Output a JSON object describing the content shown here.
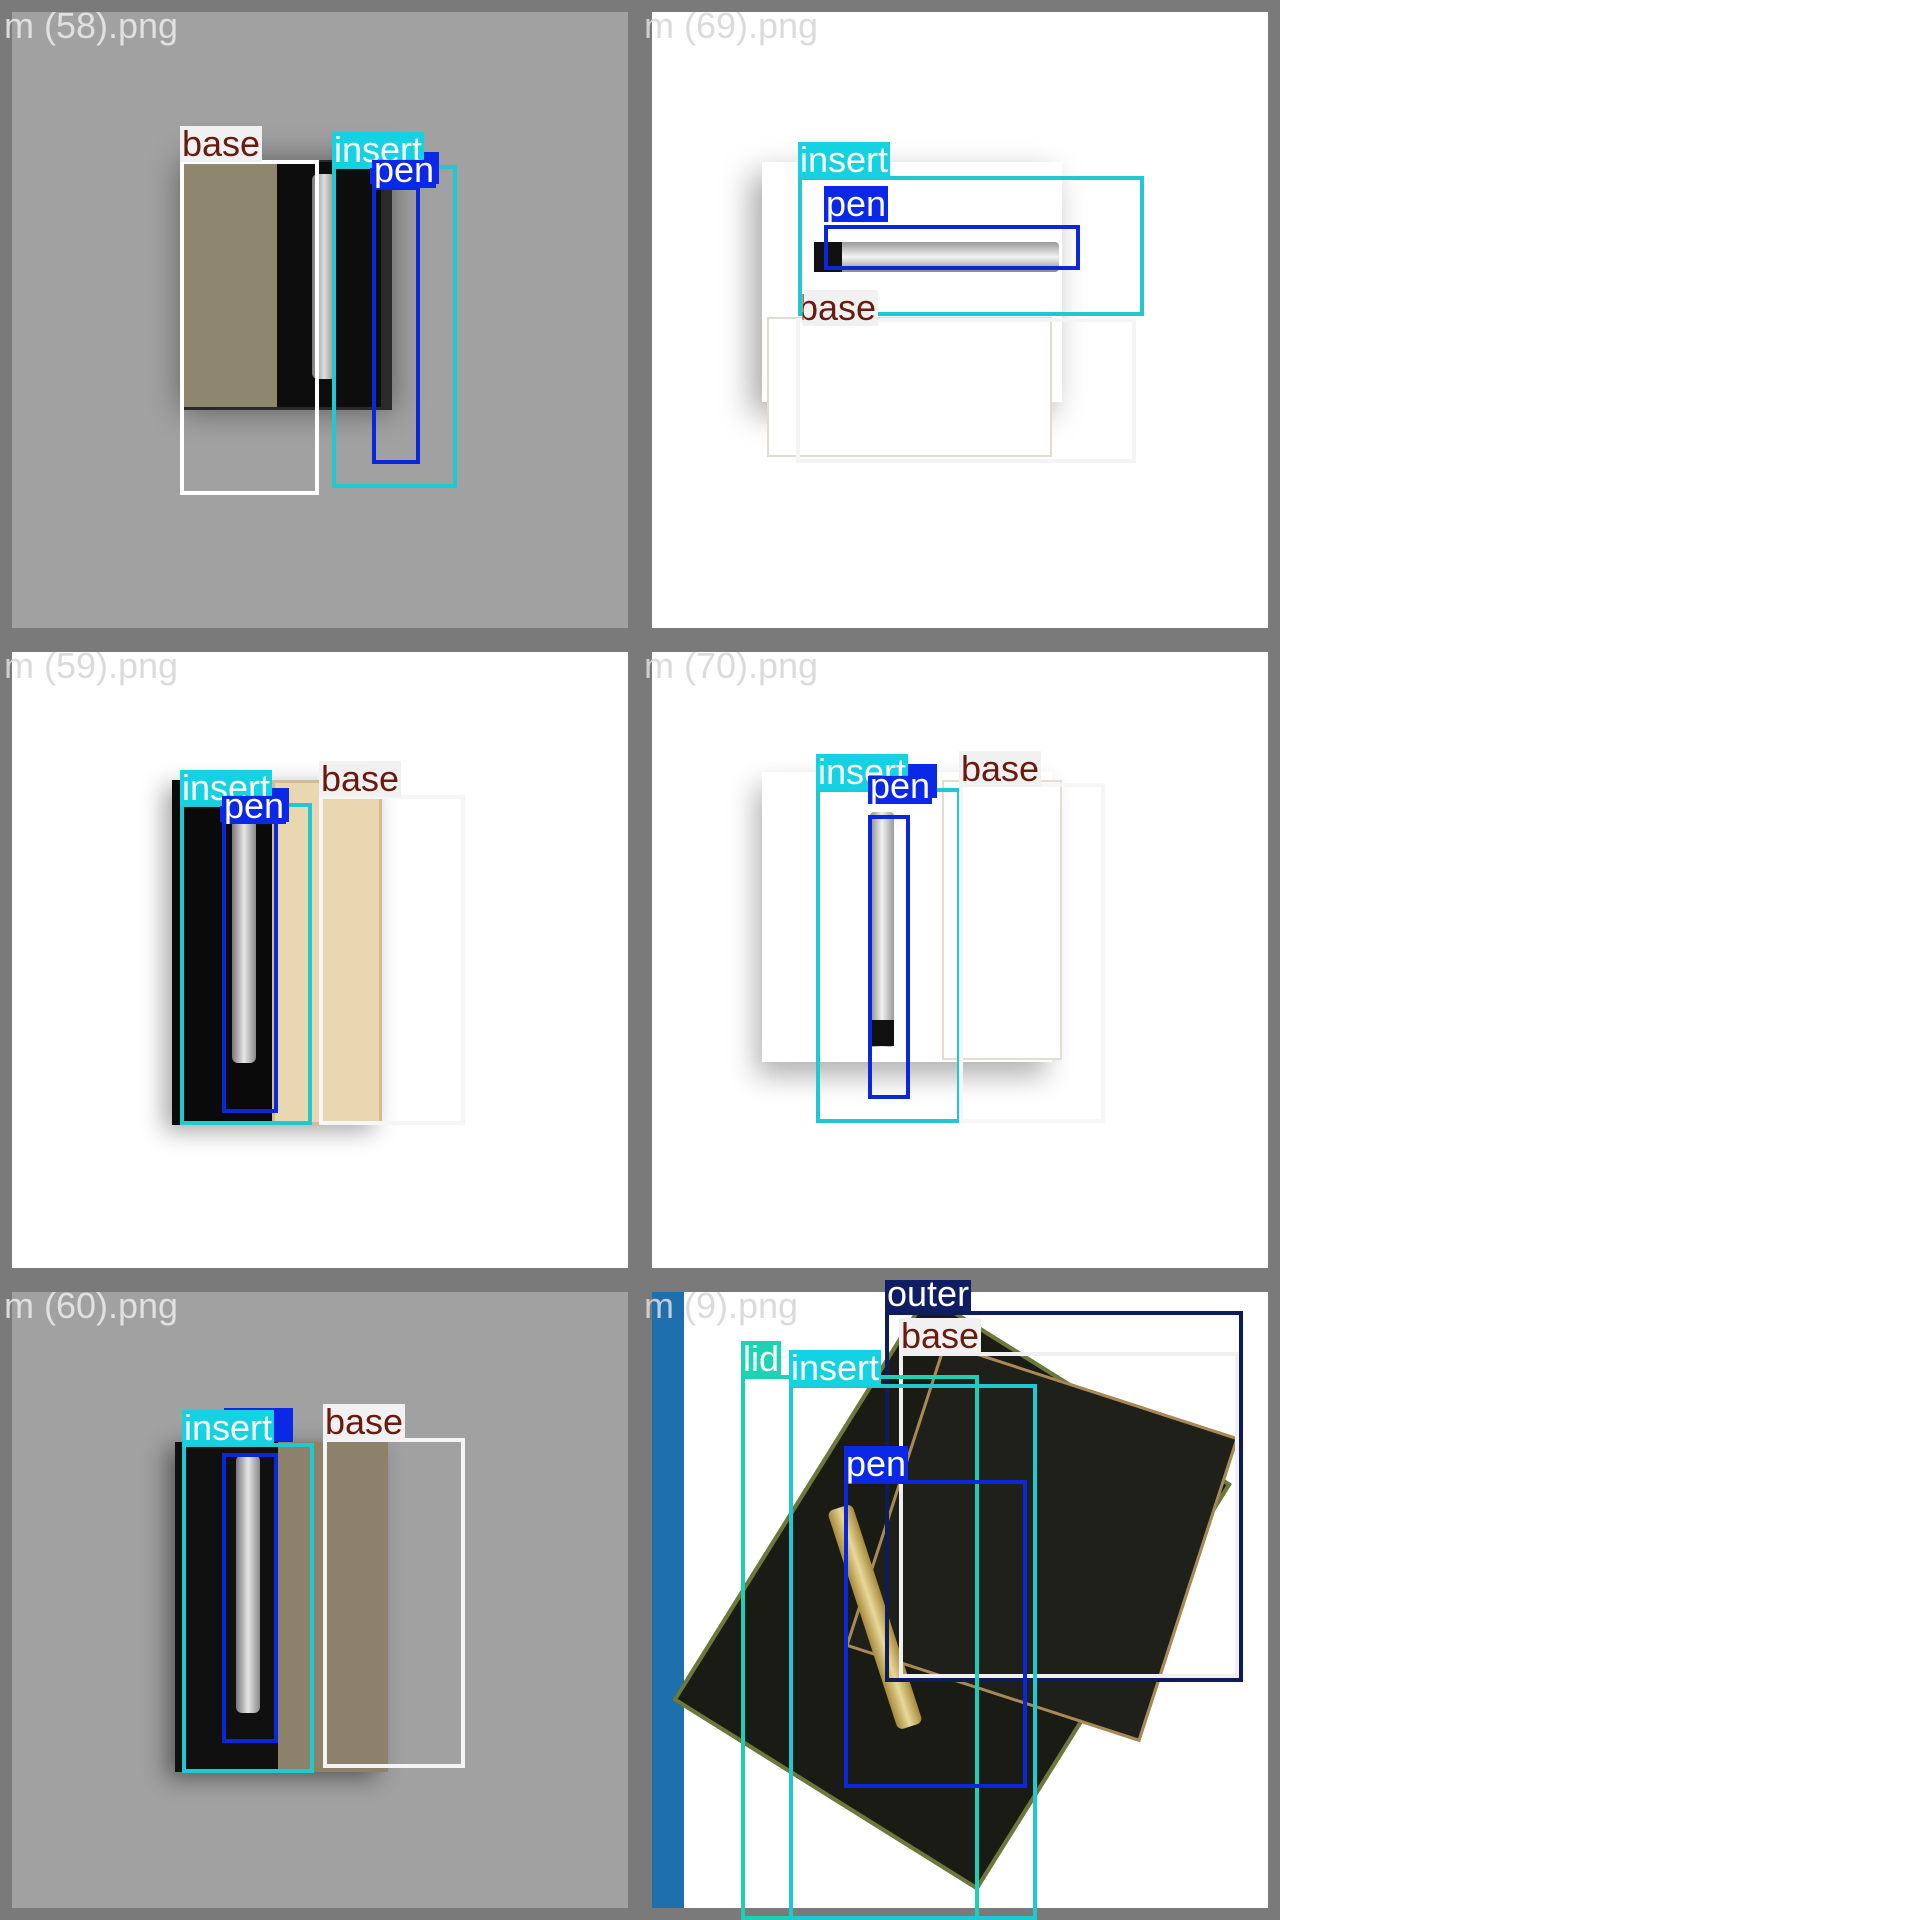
{
  "colors": {
    "base_box": "#ffffff",
    "base_label_bg": "#f1f1f1",
    "base_label_text": "#6b1a10",
    "insert_box": "#20c8d2",
    "insert_label_bg": "#14d2e1",
    "insert_label_text": "#ffffff",
    "pen_box": "#0a28d8",
    "pen_label_bg": "#0a28e6",
    "pen_label_text": "#ffffff",
    "lid_box": "#1ecfb5",
    "lid_label_bg": "#1ed2b4",
    "lid_label_text": "#ffffff",
    "outer_box": "#101c5a",
    "outer_label_bg": "#0f1e64",
    "outer_label_text": "#ffffff"
  },
  "tiles": [
    {
      "filename": "m (58).png",
      "labels": [
        "base",
        "insert",
        "pen"
      ]
    },
    {
      "filename": "m (69).png",
      "labels": [
        "insert",
        "pen",
        "base"
      ]
    },
    {
      "filename": "m (59).png",
      "labels": [
        "insert",
        "pen",
        "base"
      ]
    },
    {
      "filename": "m (70).png",
      "labels": [
        "insert",
        "pen",
        "base"
      ]
    },
    {
      "filename": "m (60).png",
      "labels": [
        "insert",
        "pen",
        "base"
      ]
    },
    {
      "filename": "m (9).png",
      "labels": [
        "outer",
        "base",
        "lid",
        "insert",
        "pen"
      ]
    }
  ]
}
